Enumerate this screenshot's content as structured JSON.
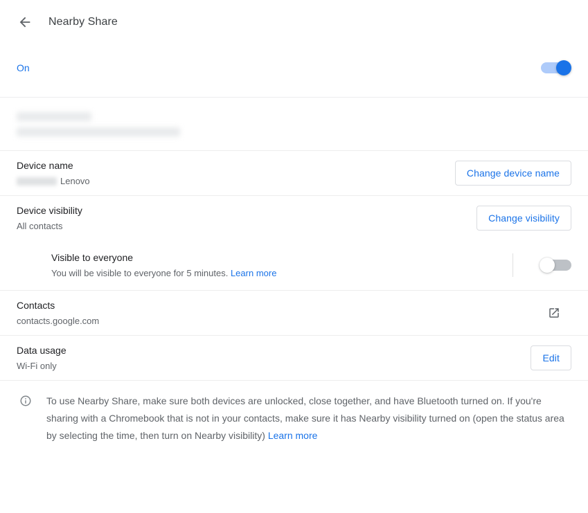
{
  "header": {
    "back_icon": "back-arrow-icon",
    "title": "Nearby Share"
  },
  "master_toggle": {
    "label": "On",
    "state": "on",
    "accent_color": "#1a73e8"
  },
  "account": {
    "name_redacted": "",
    "email_redacted": ""
  },
  "device_name": {
    "title": "Device name",
    "value_suffix": "Lenovo",
    "button_label": "Change device name"
  },
  "device_visibility": {
    "title": "Device visibility",
    "value": "All contacts",
    "button_label": "Change visibility",
    "sub": {
      "title": "Visible to everyone",
      "description": "You will be visible to everyone for 5 minutes.",
      "link_label": "Learn more",
      "toggle_state": "off"
    }
  },
  "contacts": {
    "title": "Contacts",
    "value": "contacts.google.com",
    "icon": "open-in-new-icon"
  },
  "data_usage": {
    "title": "Data usage",
    "value": "Wi-Fi only",
    "button_label": "Edit"
  },
  "footer": {
    "icon": "info-icon",
    "text": "To use Nearby Share, make sure both devices are unlocked, close together, and have Bluetooth turned on. If you're sharing with a Chromebook that is not in your contacts, make sure it has Nearby visibility turned on (open the status area by selecting the time, then turn on Nearby visibility)",
    "link_label": "Learn more"
  }
}
